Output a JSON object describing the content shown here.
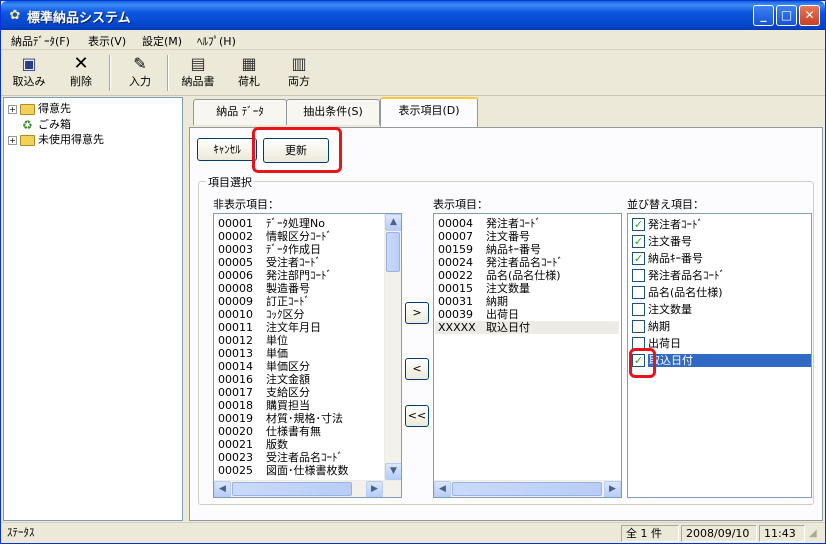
{
  "window": {
    "title": "標準納品システム",
    "controls": {
      "minimize": "_",
      "maximize": "□",
      "close": "✕"
    }
  },
  "menu": [
    "納品ﾃﾞｰﾀ(F)",
    "表示(V)",
    "設定(M)",
    "ﾍﾙﾌﾟ(H)"
  ],
  "toolbar": {
    "import": "取込み",
    "delete": "削除",
    "input": "入力",
    "delivery_slip": "納品書",
    "tag": "荷札",
    "both": "両方"
  },
  "tree": {
    "items": [
      "得意先",
      "ごみ箱",
      "未使用得意先"
    ]
  },
  "tabs": [
    "納品 ﾃﾞｰﾀ",
    "抽出条件(S)",
    "表示項目(D)"
  ],
  "buttons": {
    "cancel": "ｷｬﾝｾﾙ",
    "update": "更新"
  },
  "group_title": "項目選択",
  "hidden_items": {
    "label": "非表示項目：",
    "rows": [
      {
        "code": "00001",
        "name": "ﾃﾞｰﾀ処理No"
      },
      {
        "code": "00002",
        "name": "情報区分ｺｰﾄﾞ"
      },
      {
        "code": "00003",
        "name": "ﾃﾞｰﾀ作成日"
      },
      {
        "code": "00005",
        "name": "受注者ｺｰﾄﾞ"
      },
      {
        "code": "00006",
        "name": "発注部門ｺｰﾄﾞ"
      },
      {
        "code": "00008",
        "name": "製造番号"
      },
      {
        "code": "00009",
        "name": "訂正ｺｰﾄﾞ"
      },
      {
        "code": "00010",
        "name": "ｺｯｸ区分"
      },
      {
        "code": "00011",
        "name": "注文年月日"
      },
      {
        "code": "00012",
        "name": "単位"
      },
      {
        "code": "00013",
        "name": "単価"
      },
      {
        "code": "00014",
        "name": "単価区分"
      },
      {
        "code": "00016",
        "name": "注文金額"
      },
      {
        "code": "00017",
        "name": "支給区分"
      },
      {
        "code": "00018",
        "name": "購買担当"
      },
      {
        "code": "00019",
        "name": "材質･規格･寸法"
      },
      {
        "code": "00020",
        "name": "仕様書有無"
      },
      {
        "code": "00021",
        "name": "版数"
      },
      {
        "code": "00023",
        "name": "受注者品名ｺｰﾄﾞ"
      },
      {
        "code": "00025",
        "name": "図面･仕様書枚数"
      }
    ]
  },
  "shown_items": {
    "label": "表示項目：",
    "rows": [
      {
        "code": "00004",
        "name": "発注者ｺｰﾄﾞ"
      },
      {
        "code": "00007",
        "name": "注文番号"
      },
      {
        "code": "00159",
        "name": "納品ｷｰ番号"
      },
      {
        "code": "00024",
        "name": "発注者品名ｺｰﾄﾞ"
      },
      {
        "code": "00022",
        "name": "品名(品名仕様)"
      },
      {
        "code": "00015",
        "name": "注文数量"
      },
      {
        "code": "00031",
        "name": "納期"
      },
      {
        "code": "00039",
        "name": "出荷日"
      },
      {
        "code": "XXXXX",
        "name": "取込日付"
      }
    ]
  },
  "sort_items": {
    "label": "並び替え項目：",
    "rows": [
      {
        "name": "発注者ｺｰﾄﾞ",
        "checked": true
      },
      {
        "name": "注文番号",
        "checked": true
      },
      {
        "name": "納品ｷｰ番号",
        "checked": true
      },
      {
        "name": "発注者品名ｺｰﾄﾞ",
        "checked": false
      },
      {
        "name": "品名(品名仕様)",
        "checked": false
      },
      {
        "name": "注文数量",
        "checked": false
      },
      {
        "name": "納期",
        "checked": false
      },
      {
        "name": "出荷日",
        "checked": false
      },
      {
        "name": "取込日付",
        "checked": true
      }
    ]
  },
  "arrows": {
    "add": ">",
    "remove": "<",
    "remove_all": "<<"
  },
  "status": {
    "text": "ｽﾃｰﾀｽ",
    "count": "全 1 件",
    "date": "2008/09/10",
    "time": "11:43"
  },
  "colors": {
    "title_bar": "#0a57e0",
    "selection": "#316ac5",
    "highlight_box": "#e8141a",
    "check": "#21a121"
  }
}
